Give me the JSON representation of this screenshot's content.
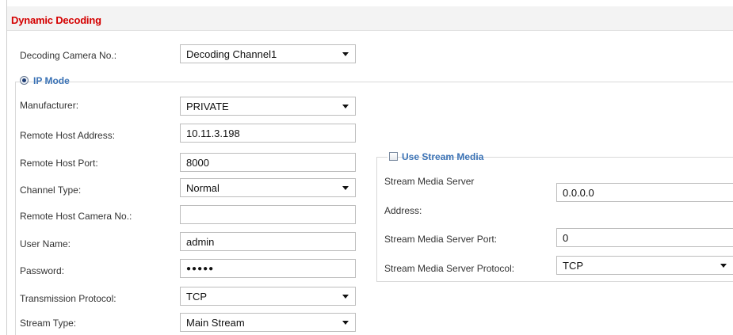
{
  "section": {
    "title": "Dynamic Decoding"
  },
  "decoding_camera": {
    "label": "Decoding Camera No.:",
    "value": "Decoding Channel1"
  },
  "ip_mode": {
    "label": "IP Mode",
    "selected": true,
    "fields": {
      "manufacturer": {
        "label": "Manufacturer:",
        "value": "PRIVATE"
      },
      "remote_host_address": {
        "label": "Remote Host Address:",
        "value": "10.11.3.198"
      },
      "remote_host_port": {
        "label": "Remote Host Port:",
        "value": "8000"
      },
      "channel_type": {
        "label": "Channel Type:",
        "value": "Normal"
      },
      "remote_host_camera_no": {
        "label": "Remote Host Camera No.:",
        "value": ""
      },
      "user_name": {
        "label": "User Name:",
        "value": "admin"
      },
      "password": {
        "label": "Password:",
        "value": "●●●●●"
      },
      "transmission_protocol": {
        "label": "Transmission Protocol:",
        "value": "TCP"
      },
      "stream_type": {
        "label": "Stream Type:",
        "value": "Main Stream"
      }
    }
  },
  "stream_media": {
    "label": "Use Stream Media",
    "checked": false,
    "server_address_label_line1": "Stream Media Server",
    "server_address_label_line2": "Address:",
    "server_address": "0.0.0.0",
    "server_port_label": "Stream Media Server Port:",
    "server_port": "0",
    "server_protocol_label": "Stream Media Server Protocol:",
    "server_protocol": "TCP"
  },
  "colors": {
    "title_red": "#d40000",
    "legend_blue": "#3a72b5"
  },
  "icons": {
    "select_arrow": "chevron-down-icon",
    "radio": "radio-selected-icon",
    "checkbox": "checkbox-unchecked-icon"
  }
}
